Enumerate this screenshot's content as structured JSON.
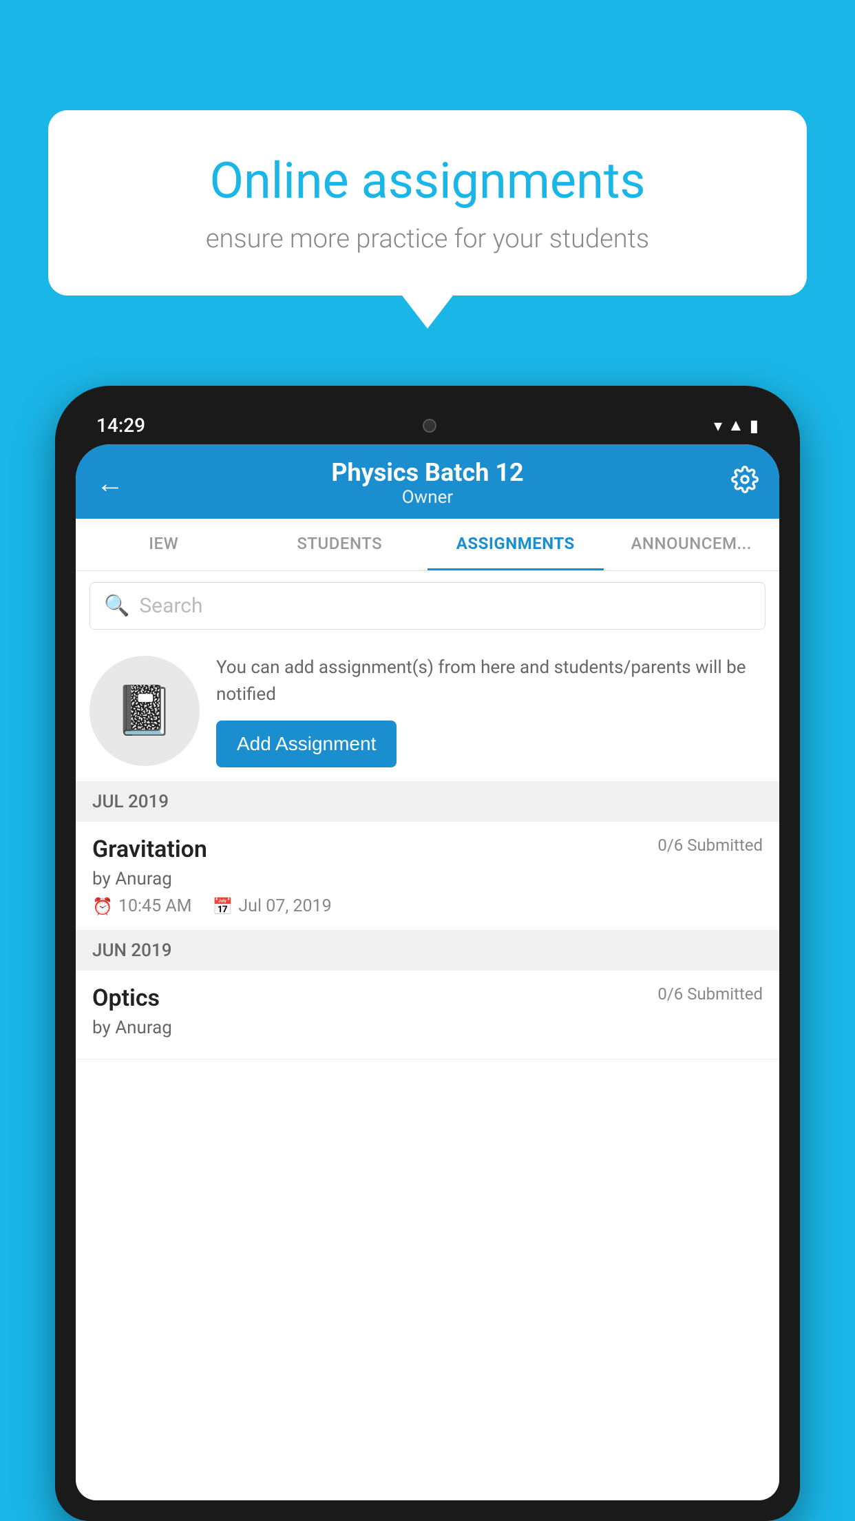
{
  "background": {
    "color": "#1ab6e8"
  },
  "speech_bubble": {
    "title": "Online assignments",
    "subtitle": "ensure more practice for your students"
  },
  "phone": {
    "time": "14:29",
    "header": {
      "title": "Physics Batch 12",
      "subtitle": "Owner"
    },
    "tabs": [
      {
        "label": "IEW",
        "active": false
      },
      {
        "label": "STUDENTS",
        "active": false
      },
      {
        "label": "ASSIGNMENTS",
        "active": true
      },
      {
        "label": "ANNOUNCEMENTS",
        "active": false
      }
    ],
    "search": {
      "placeholder": "Search"
    },
    "add_assignment": {
      "description": "You can add assignment(s) from here and students/parents will be notified",
      "button_label": "Add Assignment"
    },
    "sections": [
      {
        "header": "JUL 2019",
        "items": [
          {
            "name": "Gravitation",
            "submitted": "0/6 Submitted",
            "by": "by Anurag",
            "time": "10:45 AM",
            "date": "Jul 07, 2019"
          }
        ]
      },
      {
        "header": "JUN 2019",
        "items": [
          {
            "name": "Optics",
            "submitted": "0/6 Submitted",
            "by": "by Anurag",
            "time": "",
            "date": ""
          }
        ]
      }
    ]
  }
}
